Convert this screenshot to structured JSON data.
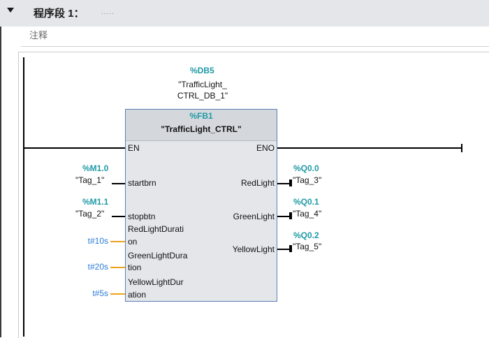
{
  "network": {
    "title": "程序段 1：",
    "title_dots": ".....",
    "comment": "注释"
  },
  "instance_db": {
    "address": "%DB5",
    "name_line1": "\"TrafficLight_",
    "name_line2": "CTRL_DB_1\""
  },
  "block": {
    "address": "%FB1",
    "name": "\"TrafficLight_CTRL\"",
    "inputs": [
      "EN",
      "startbrn",
      "stopbtn",
      "RedLightDurati",
      "on",
      "GreenLightDura",
      "tion",
      "YellowLightDur",
      "ation"
    ],
    "outputs": [
      "ENO",
      "RedLight",
      "GreenLight",
      "YellowLight"
    ]
  },
  "operands_in": [
    {
      "address": "%M1.0",
      "symbol": "\"Tag_1\""
    },
    {
      "address": "%M1.1",
      "symbol": "\"Tag_2\""
    },
    {
      "value": "t#10s"
    },
    {
      "value": "t#20s"
    },
    {
      "value": "t#5s"
    }
  ],
  "operands_out": [
    {
      "address": "%Q0.0",
      "symbol": "\"Tag_3\""
    },
    {
      "address": "%Q0.1",
      "symbol": "\"Tag_4\""
    },
    {
      "address": "%Q0.2",
      "symbol": "\"Tag_5\""
    }
  ],
  "colors": {
    "address_teal": "#1f9aa5",
    "constant_blue": "#2a7bd8",
    "constant_wire_orange": "#f0a21b",
    "block_border": "#5a7fb5"
  },
  "icons": {
    "collapse": "triangle-down"
  }
}
